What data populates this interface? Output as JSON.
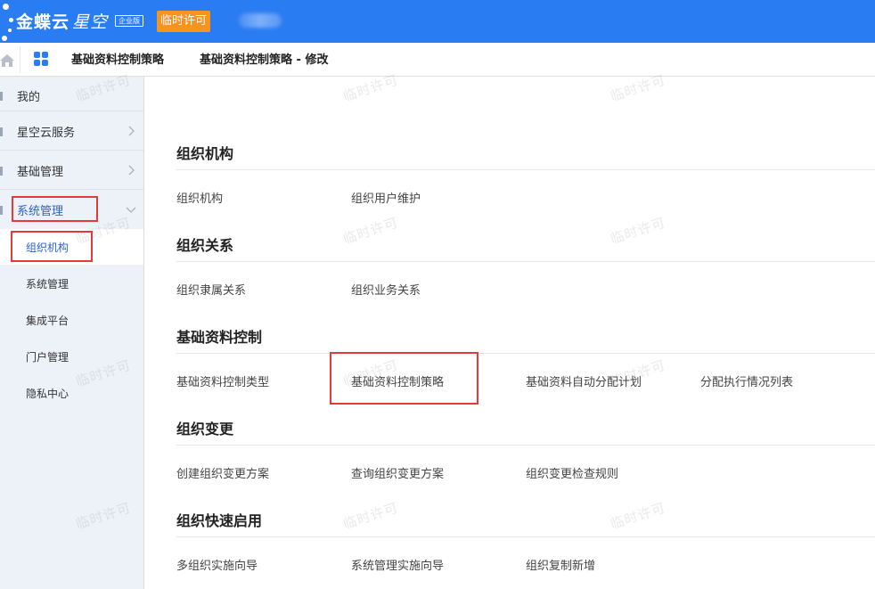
{
  "header": {
    "brand": "金蝶云",
    "product": "星空",
    "edition": "企业版",
    "license_button": "临时许可"
  },
  "tabs": {
    "tab1": "基础资料控制策略",
    "tab2": "基础资料控制策略 - 修改"
  },
  "sidebar": {
    "items": [
      {
        "label": "我的"
      },
      {
        "label": "星空云服务"
      },
      {
        "label": "基础管理"
      },
      {
        "label": "系统管理"
      }
    ],
    "subitems": [
      {
        "label": "组织机构"
      },
      {
        "label": "系统管理"
      },
      {
        "label": "集成平台"
      },
      {
        "label": "门户管理"
      },
      {
        "label": "隐私中心"
      }
    ]
  },
  "main": {
    "sections": [
      {
        "title": "组织机构",
        "links": [
          "组织机构",
          "组织用户维护"
        ]
      },
      {
        "title": "组织关系",
        "links": [
          "组织隶属关系",
          "组织业务关系"
        ]
      },
      {
        "title": "基础资料控制",
        "links": [
          "基础资料控制类型",
          "基础资料控制策略",
          "基础资料自动分配计划",
          "分配执行情况列表"
        ]
      },
      {
        "title": "组织变更",
        "links": [
          "创建组织变更方案",
          "查询组织变更方案",
          "组织变更检查规则"
        ]
      },
      {
        "title": "组织快速启用",
        "links": [
          "多组织实施向导",
          "系统管理实施向导",
          "组织复制新增"
        ]
      }
    ]
  },
  "watermark": "临时许可",
  "colors": {
    "header_bg": "#2a7cf2",
    "license_bg": "#f7941d",
    "highlight": "#e23b3b",
    "active_text": "#2a63d6"
  }
}
